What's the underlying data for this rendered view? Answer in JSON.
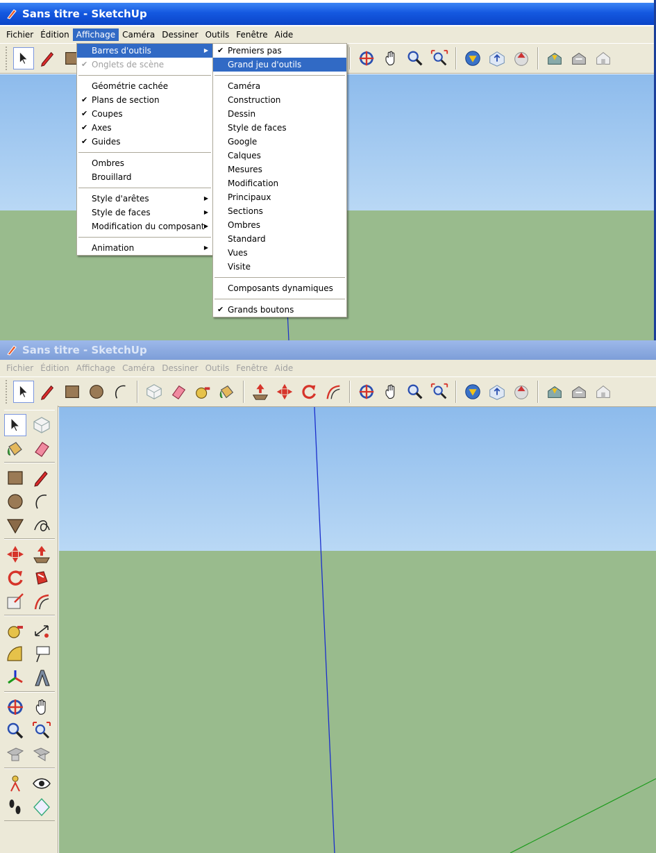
{
  "window": {
    "title": "Sans titre - SketchUp"
  },
  "menubar": [
    "Fichier",
    "Édition",
    "Affichage",
    "Caméra",
    "Dessiner",
    "Outils",
    "Fenêtre",
    "Aide"
  ],
  "affichage_menu": {
    "items": [
      {
        "label": "Barres d'outils",
        "submenu": true,
        "highlighted": true
      },
      {
        "label": "Onglets de scène",
        "checked": true,
        "disabled": true
      },
      {
        "separator": true
      },
      {
        "label": "Géométrie cachée"
      },
      {
        "label": "Plans de section",
        "checked": true
      },
      {
        "label": "Coupes",
        "checked": true
      },
      {
        "label": "Axes",
        "checked": true
      },
      {
        "label": "Guides",
        "checked": true
      },
      {
        "separator": true
      },
      {
        "label": "Ombres"
      },
      {
        "label": "Brouillard"
      },
      {
        "separator": true
      },
      {
        "label": "Style d'arêtes",
        "submenu": true
      },
      {
        "label": "Style de faces",
        "submenu": true
      },
      {
        "label": "Modification du composant",
        "submenu": true
      },
      {
        "separator": true
      },
      {
        "label": "Animation",
        "submenu": true
      }
    ]
  },
  "toolbars_submenu": {
    "items": [
      {
        "label": "Premiers pas",
        "checked": true
      },
      {
        "label": "Grand jeu d'outils",
        "highlighted": true
      },
      {
        "separator": true
      },
      {
        "label": "Caméra"
      },
      {
        "label": "Construction"
      },
      {
        "label": "Dessin"
      },
      {
        "label": "Style de faces"
      },
      {
        "label": "Google"
      },
      {
        "label": "Calques"
      },
      {
        "label": "Mesures"
      },
      {
        "label": "Modification"
      },
      {
        "label": "Principaux"
      },
      {
        "label": "Sections"
      },
      {
        "label": "Ombres"
      },
      {
        "label": "Standard"
      },
      {
        "label": "Vues"
      },
      {
        "label": "Visite"
      },
      {
        "separator": true
      },
      {
        "label": "Composants dynamiques"
      },
      {
        "separator": true
      },
      {
        "label": "Grands boutons",
        "checked": true
      }
    ]
  },
  "toolbar_icons": [
    "select-icon",
    "pencil-icon",
    "rectangle-icon",
    "circle-icon",
    "arc-icon",
    "make-component-icon",
    "eraser-icon",
    "tape-measure-icon",
    "paint-bucket-icon",
    "push-pull-icon",
    "move-icon",
    "rotate-icon",
    "offset-icon",
    "orbit-icon",
    "pan-icon",
    "zoom-icon",
    "zoom-extents-icon",
    "get-models-icon",
    "share-model-icon",
    "share-component-icon",
    "get-models-3d-icon",
    "place-model-icon",
    "photo-textures-icon"
  ],
  "side_toolbar_groups": [
    [
      [
        "select-icon",
        "make-component-icon"
      ],
      [
        "paint-bucket-icon",
        "eraser-icon"
      ]
    ],
    [
      [
        "rectangle-icon",
        "pencil-icon"
      ],
      [
        "circle-icon",
        "arc-icon"
      ],
      [
        "polygon-icon",
        "freehand-icon"
      ]
    ],
    [
      [
        "move-icon",
        "push-pull-icon"
      ],
      [
        "rotate-icon",
        "follow-me-icon"
      ],
      [
        "scale-icon",
        "offset-icon"
      ]
    ],
    [
      [
        "tape-measure-icon",
        "dimension-icon"
      ],
      [
        "protractor-icon",
        "text-icon"
      ],
      [
        "axes-icon",
        "3d-text-icon"
      ]
    ],
    [
      [
        "orbit-icon",
        "pan-icon"
      ],
      [
        "zoom-icon",
        "zoom-extents-icon"
      ],
      [
        "previous-view-icon",
        "next-view-icon"
      ]
    ],
    [
      [
        "position-camera-icon",
        "look-around-icon"
      ],
      [
        "walk-icon",
        "section-plane-icon"
      ]
    ]
  ],
  "colors": {
    "sky": "#a7cbf0",
    "ground": "#99bb8d",
    "menu_highlight": "#316ac5",
    "titlebar": "#1458e0"
  }
}
